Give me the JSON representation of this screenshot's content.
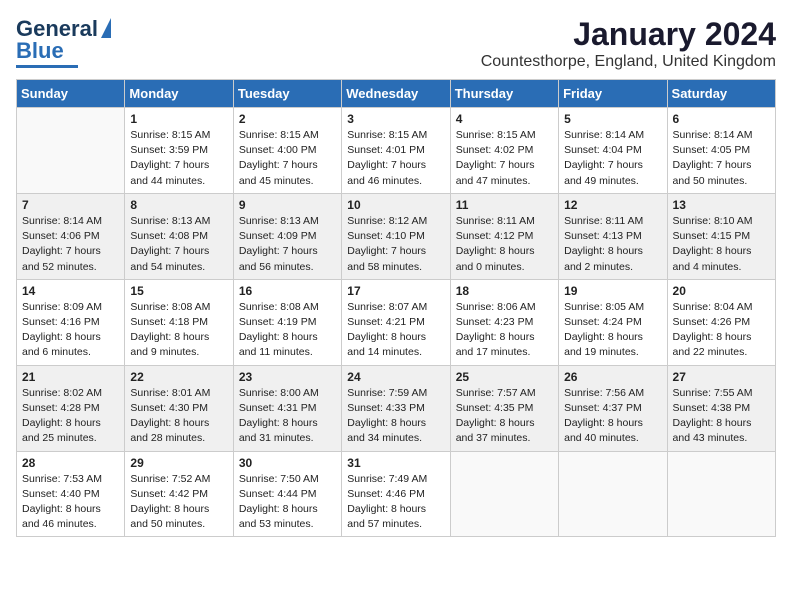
{
  "header": {
    "logo_line1": "General",
    "logo_line2": "Blue",
    "title": "January 2024",
    "subtitle": "Countesthorpe, England, United Kingdom"
  },
  "columns": [
    "Sunday",
    "Monday",
    "Tuesday",
    "Wednesday",
    "Thursday",
    "Friday",
    "Saturday"
  ],
  "weeks": [
    [
      {
        "day": "",
        "sunrise": "",
        "sunset": "",
        "daylight": ""
      },
      {
        "day": "1",
        "sunrise": "Sunrise: 8:15 AM",
        "sunset": "Sunset: 3:59 PM",
        "daylight": "Daylight: 7 hours and 44 minutes."
      },
      {
        "day": "2",
        "sunrise": "Sunrise: 8:15 AM",
        "sunset": "Sunset: 4:00 PM",
        "daylight": "Daylight: 7 hours and 45 minutes."
      },
      {
        "day": "3",
        "sunrise": "Sunrise: 8:15 AM",
        "sunset": "Sunset: 4:01 PM",
        "daylight": "Daylight: 7 hours and 46 minutes."
      },
      {
        "day": "4",
        "sunrise": "Sunrise: 8:15 AM",
        "sunset": "Sunset: 4:02 PM",
        "daylight": "Daylight: 7 hours and 47 minutes."
      },
      {
        "day": "5",
        "sunrise": "Sunrise: 8:14 AM",
        "sunset": "Sunset: 4:04 PM",
        "daylight": "Daylight: 7 hours and 49 minutes."
      },
      {
        "day": "6",
        "sunrise": "Sunrise: 8:14 AM",
        "sunset": "Sunset: 4:05 PM",
        "daylight": "Daylight: 7 hours and 50 minutes."
      }
    ],
    [
      {
        "day": "7",
        "sunrise": "Sunrise: 8:14 AM",
        "sunset": "Sunset: 4:06 PM",
        "daylight": "Daylight: 7 hours and 52 minutes."
      },
      {
        "day": "8",
        "sunrise": "Sunrise: 8:13 AM",
        "sunset": "Sunset: 4:08 PM",
        "daylight": "Daylight: 7 hours and 54 minutes."
      },
      {
        "day": "9",
        "sunrise": "Sunrise: 8:13 AM",
        "sunset": "Sunset: 4:09 PM",
        "daylight": "Daylight: 7 hours and 56 minutes."
      },
      {
        "day": "10",
        "sunrise": "Sunrise: 8:12 AM",
        "sunset": "Sunset: 4:10 PM",
        "daylight": "Daylight: 7 hours and 58 minutes."
      },
      {
        "day": "11",
        "sunrise": "Sunrise: 8:11 AM",
        "sunset": "Sunset: 4:12 PM",
        "daylight": "Daylight: 8 hours and 0 minutes."
      },
      {
        "day": "12",
        "sunrise": "Sunrise: 8:11 AM",
        "sunset": "Sunset: 4:13 PM",
        "daylight": "Daylight: 8 hours and 2 minutes."
      },
      {
        "day": "13",
        "sunrise": "Sunrise: 8:10 AM",
        "sunset": "Sunset: 4:15 PM",
        "daylight": "Daylight: 8 hours and 4 minutes."
      }
    ],
    [
      {
        "day": "14",
        "sunrise": "Sunrise: 8:09 AM",
        "sunset": "Sunset: 4:16 PM",
        "daylight": "Daylight: 8 hours and 6 minutes."
      },
      {
        "day": "15",
        "sunrise": "Sunrise: 8:08 AM",
        "sunset": "Sunset: 4:18 PM",
        "daylight": "Daylight: 8 hours and 9 minutes."
      },
      {
        "day": "16",
        "sunrise": "Sunrise: 8:08 AM",
        "sunset": "Sunset: 4:19 PM",
        "daylight": "Daylight: 8 hours and 11 minutes."
      },
      {
        "day": "17",
        "sunrise": "Sunrise: 8:07 AM",
        "sunset": "Sunset: 4:21 PM",
        "daylight": "Daylight: 8 hours and 14 minutes."
      },
      {
        "day": "18",
        "sunrise": "Sunrise: 8:06 AM",
        "sunset": "Sunset: 4:23 PM",
        "daylight": "Daylight: 8 hours and 17 minutes."
      },
      {
        "day": "19",
        "sunrise": "Sunrise: 8:05 AM",
        "sunset": "Sunset: 4:24 PM",
        "daylight": "Daylight: 8 hours and 19 minutes."
      },
      {
        "day": "20",
        "sunrise": "Sunrise: 8:04 AM",
        "sunset": "Sunset: 4:26 PM",
        "daylight": "Daylight: 8 hours and 22 minutes."
      }
    ],
    [
      {
        "day": "21",
        "sunrise": "Sunrise: 8:02 AM",
        "sunset": "Sunset: 4:28 PM",
        "daylight": "Daylight: 8 hours and 25 minutes."
      },
      {
        "day": "22",
        "sunrise": "Sunrise: 8:01 AM",
        "sunset": "Sunset: 4:30 PM",
        "daylight": "Daylight: 8 hours and 28 minutes."
      },
      {
        "day": "23",
        "sunrise": "Sunrise: 8:00 AM",
        "sunset": "Sunset: 4:31 PM",
        "daylight": "Daylight: 8 hours and 31 minutes."
      },
      {
        "day": "24",
        "sunrise": "Sunrise: 7:59 AM",
        "sunset": "Sunset: 4:33 PM",
        "daylight": "Daylight: 8 hours and 34 minutes."
      },
      {
        "day": "25",
        "sunrise": "Sunrise: 7:57 AM",
        "sunset": "Sunset: 4:35 PM",
        "daylight": "Daylight: 8 hours and 37 minutes."
      },
      {
        "day": "26",
        "sunrise": "Sunrise: 7:56 AM",
        "sunset": "Sunset: 4:37 PM",
        "daylight": "Daylight: 8 hours and 40 minutes."
      },
      {
        "day": "27",
        "sunrise": "Sunrise: 7:55 AM",
        "sunset": "Sunset: 4:38 PM",
        "daylight": "Daylight: 8 hours and 43 minutes."
      }
    ],
    [
      {
        "day": "28",
        "sunrise": "Sunrise: 7:53 AM",
        "sunset": "Sunset: 4:40 PM",
        "daylight": "Daylight: 8 hours and 46 minutes."
      },
      {
        "day": "29",
        "sunrise": "Sunrise: 7:52 AM",
        "sunset": "Sunset: 4:42 PM",
        "daylight": "Daylight: 8 hours and 50 minutes."
      },
      {
        "day": "30",
        "sunrise": "Sunrise: 7:50 AM",
        "sunset": "Sunset: 4:44 PM",
        "daylight": "Daylight: 8 hours and 53 minutes."
      },
      {
        "day": "31",
        "sunrise": "Sunrise: 7:49 AM",
        "sunset": "Sunset: 4:46 PM",
        "daylight": "Daylight: 8 hours and 57 minutes."
      },
      {
        "day": "",
        "sunrise": "",
        "sunset": "",
        "daylight": ""
      },
      {
        "day": "",
        "sunrise": "",
        "sunset": "",
        "daylight": ""
      },
      {
        "day": "",
        "sunrise": "",
        "sunset": "",
        "daylight": ""
      }
    ]
  ]
}
